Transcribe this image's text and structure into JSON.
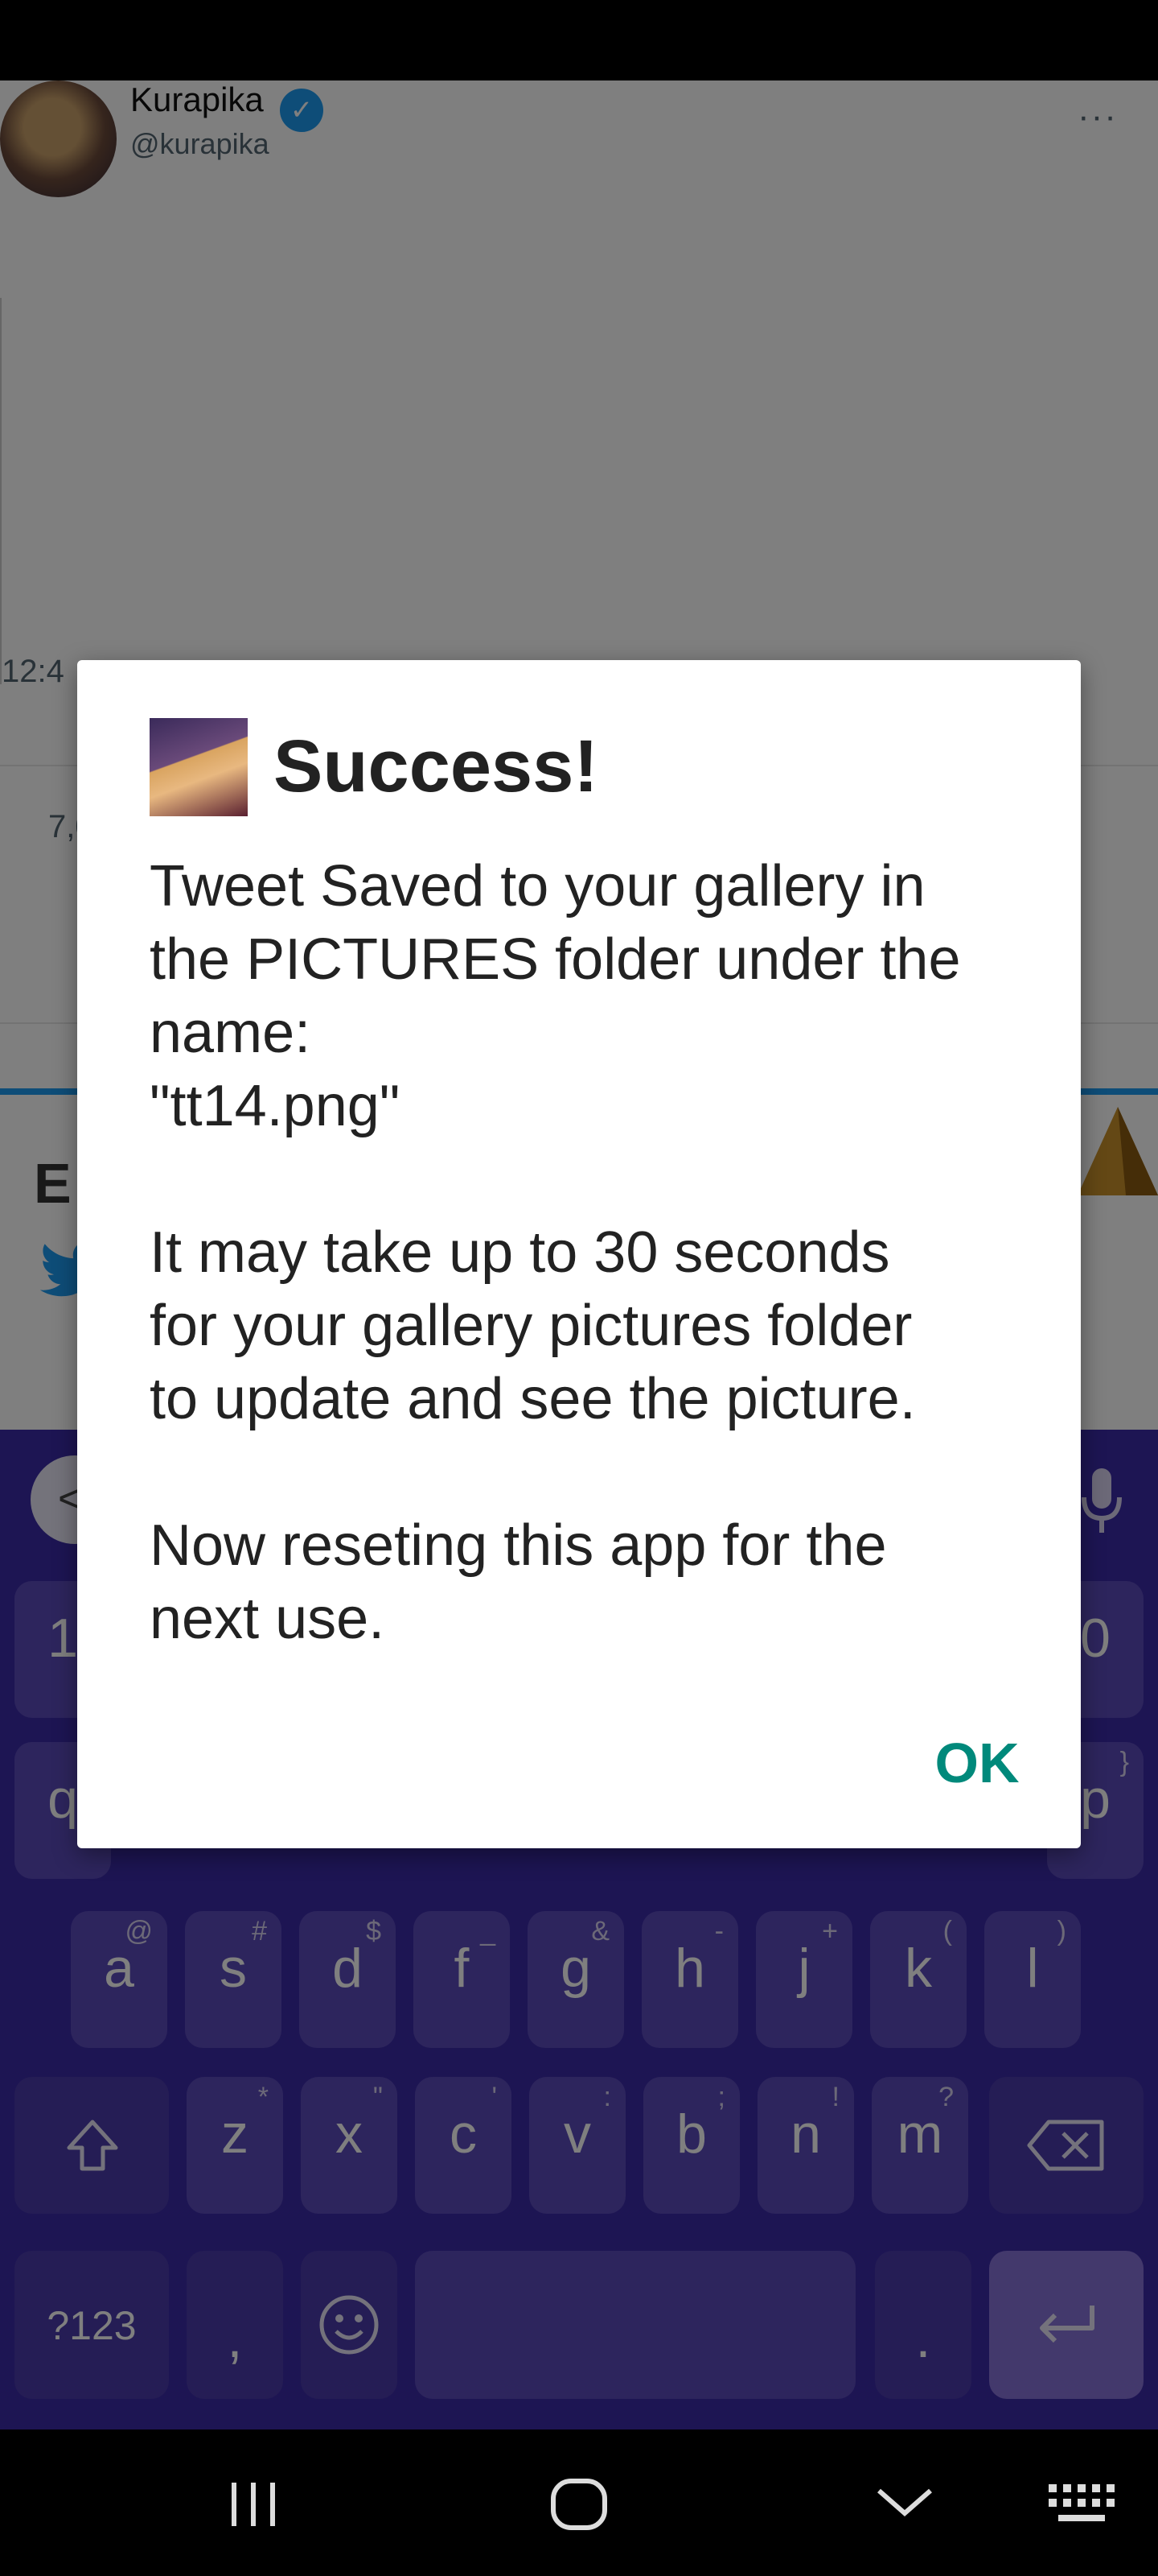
{
  "profile": {
    "name": "Kurapika",
    "handle": "@kurapika",
    "more_label": "···"
  },
  "tweet": {
    "time_fragment": "12:4",
    "stats_fragment": "7,0"
  },
  "background": {
    "heading_fragment": "E"
  },
  "keyboard": {
    "toolbar_left": "<",
    "row_digits_left": "1",
    "row_digits_right": "0",
    "row_q_left": "q",
    "row_q_right": "p",
    "row_q_right_sup": "}",
    "row2": [
      {
        "label": "a",
        "sup": "@"
      },
      {
        "label": "s",
        "sup": "#"
      },
      {
        "label": "d",
        "sup": "$"
      },
      {
        "label": "f",
        "sup": "_"
      },
      {
        "label": "g",
        "sup": "&"
      },
      {
        "label": "h",
        "sup": "-"
      },
      {
        "label": "j",
        "sup": "+"
      },
      {
        "label": "k",
        "sup": "("
      },
      {
        "label": "l",
        "sup": ")"
      }
    ],
    "row3": [
      {
        "label": "z",
        "sup": "*"
      },
      {
        "label": "x",
        "sup": "\""
      },
      {
        "label": "c",
        "sup": "'"
      },
      {
        "label": "v",
        "sup": ":"
      },
      {
        "label": "b",
        "sup": ";"
      },
      {
        "label": "n",
        "sup": "!"
      },
      {
        "label": "m",
        "sup": "?"
      }
    ],
    "symbols_label": "?123",
    "comma_label": ",",
    "period_label": "."
  },
  "dialog": {
    "title": "Success!",
    "body": "Tweet Saved to your gallery in\nthe PICTURES folder under the\nname:\n\"tt14.png\"\n\nIt may take up to 30 seconds\nfor your gallery pictures folder\nto update and see the picture.\n\nNow reseting this app for the\nnext use.",
    "ok_label": "OK"
  }
}
